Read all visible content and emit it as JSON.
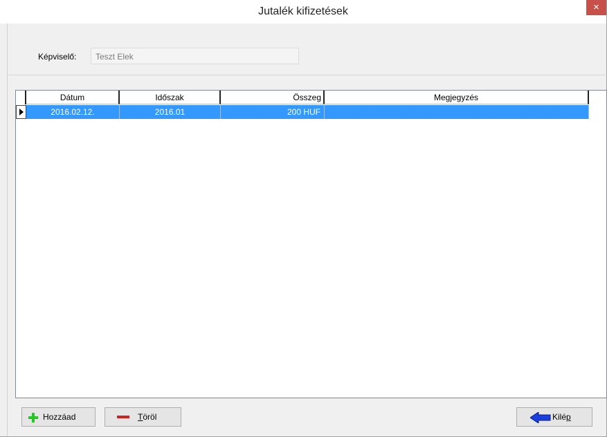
{
  "window": {
    "title": "Jutalék kifizetések",
    "close_glyph": "×"
  },
  "form": {
    "rep_label": "Képviselő:",
    "rep_value": "Teszt Elek"
  },
  "grid": {
    "columns": [
      "Dátum",
      "Időszak",
      "Összeg",
      "Megjegyzés"
    ],
    "rows": [
      {
        "datum": "2016.02.12.",
        "idoszak": "2016.01",
        "osszeg": "200 HUF",
        "megjegyzes": ""
      }
    ],
    "selected_row": 0,
    "selection_color": "#3399ff"
  },
  "buttons": {
    "add": {
      "prefix": "Hozzáad",
      "underline": "",
      "suffix": "",
      "icon": "plus-icon"
    },
    "delete": {
      "prefix": "",
      "underline": "T",
      "suffix": "öröl",
      "icon": "minus-icon"
    },
    "exit": {
      "prefix": "Kilé",
      "underline": "p",
      "suffix": "",
      "icon": "arrow-left-icon"
    }
  }
}
